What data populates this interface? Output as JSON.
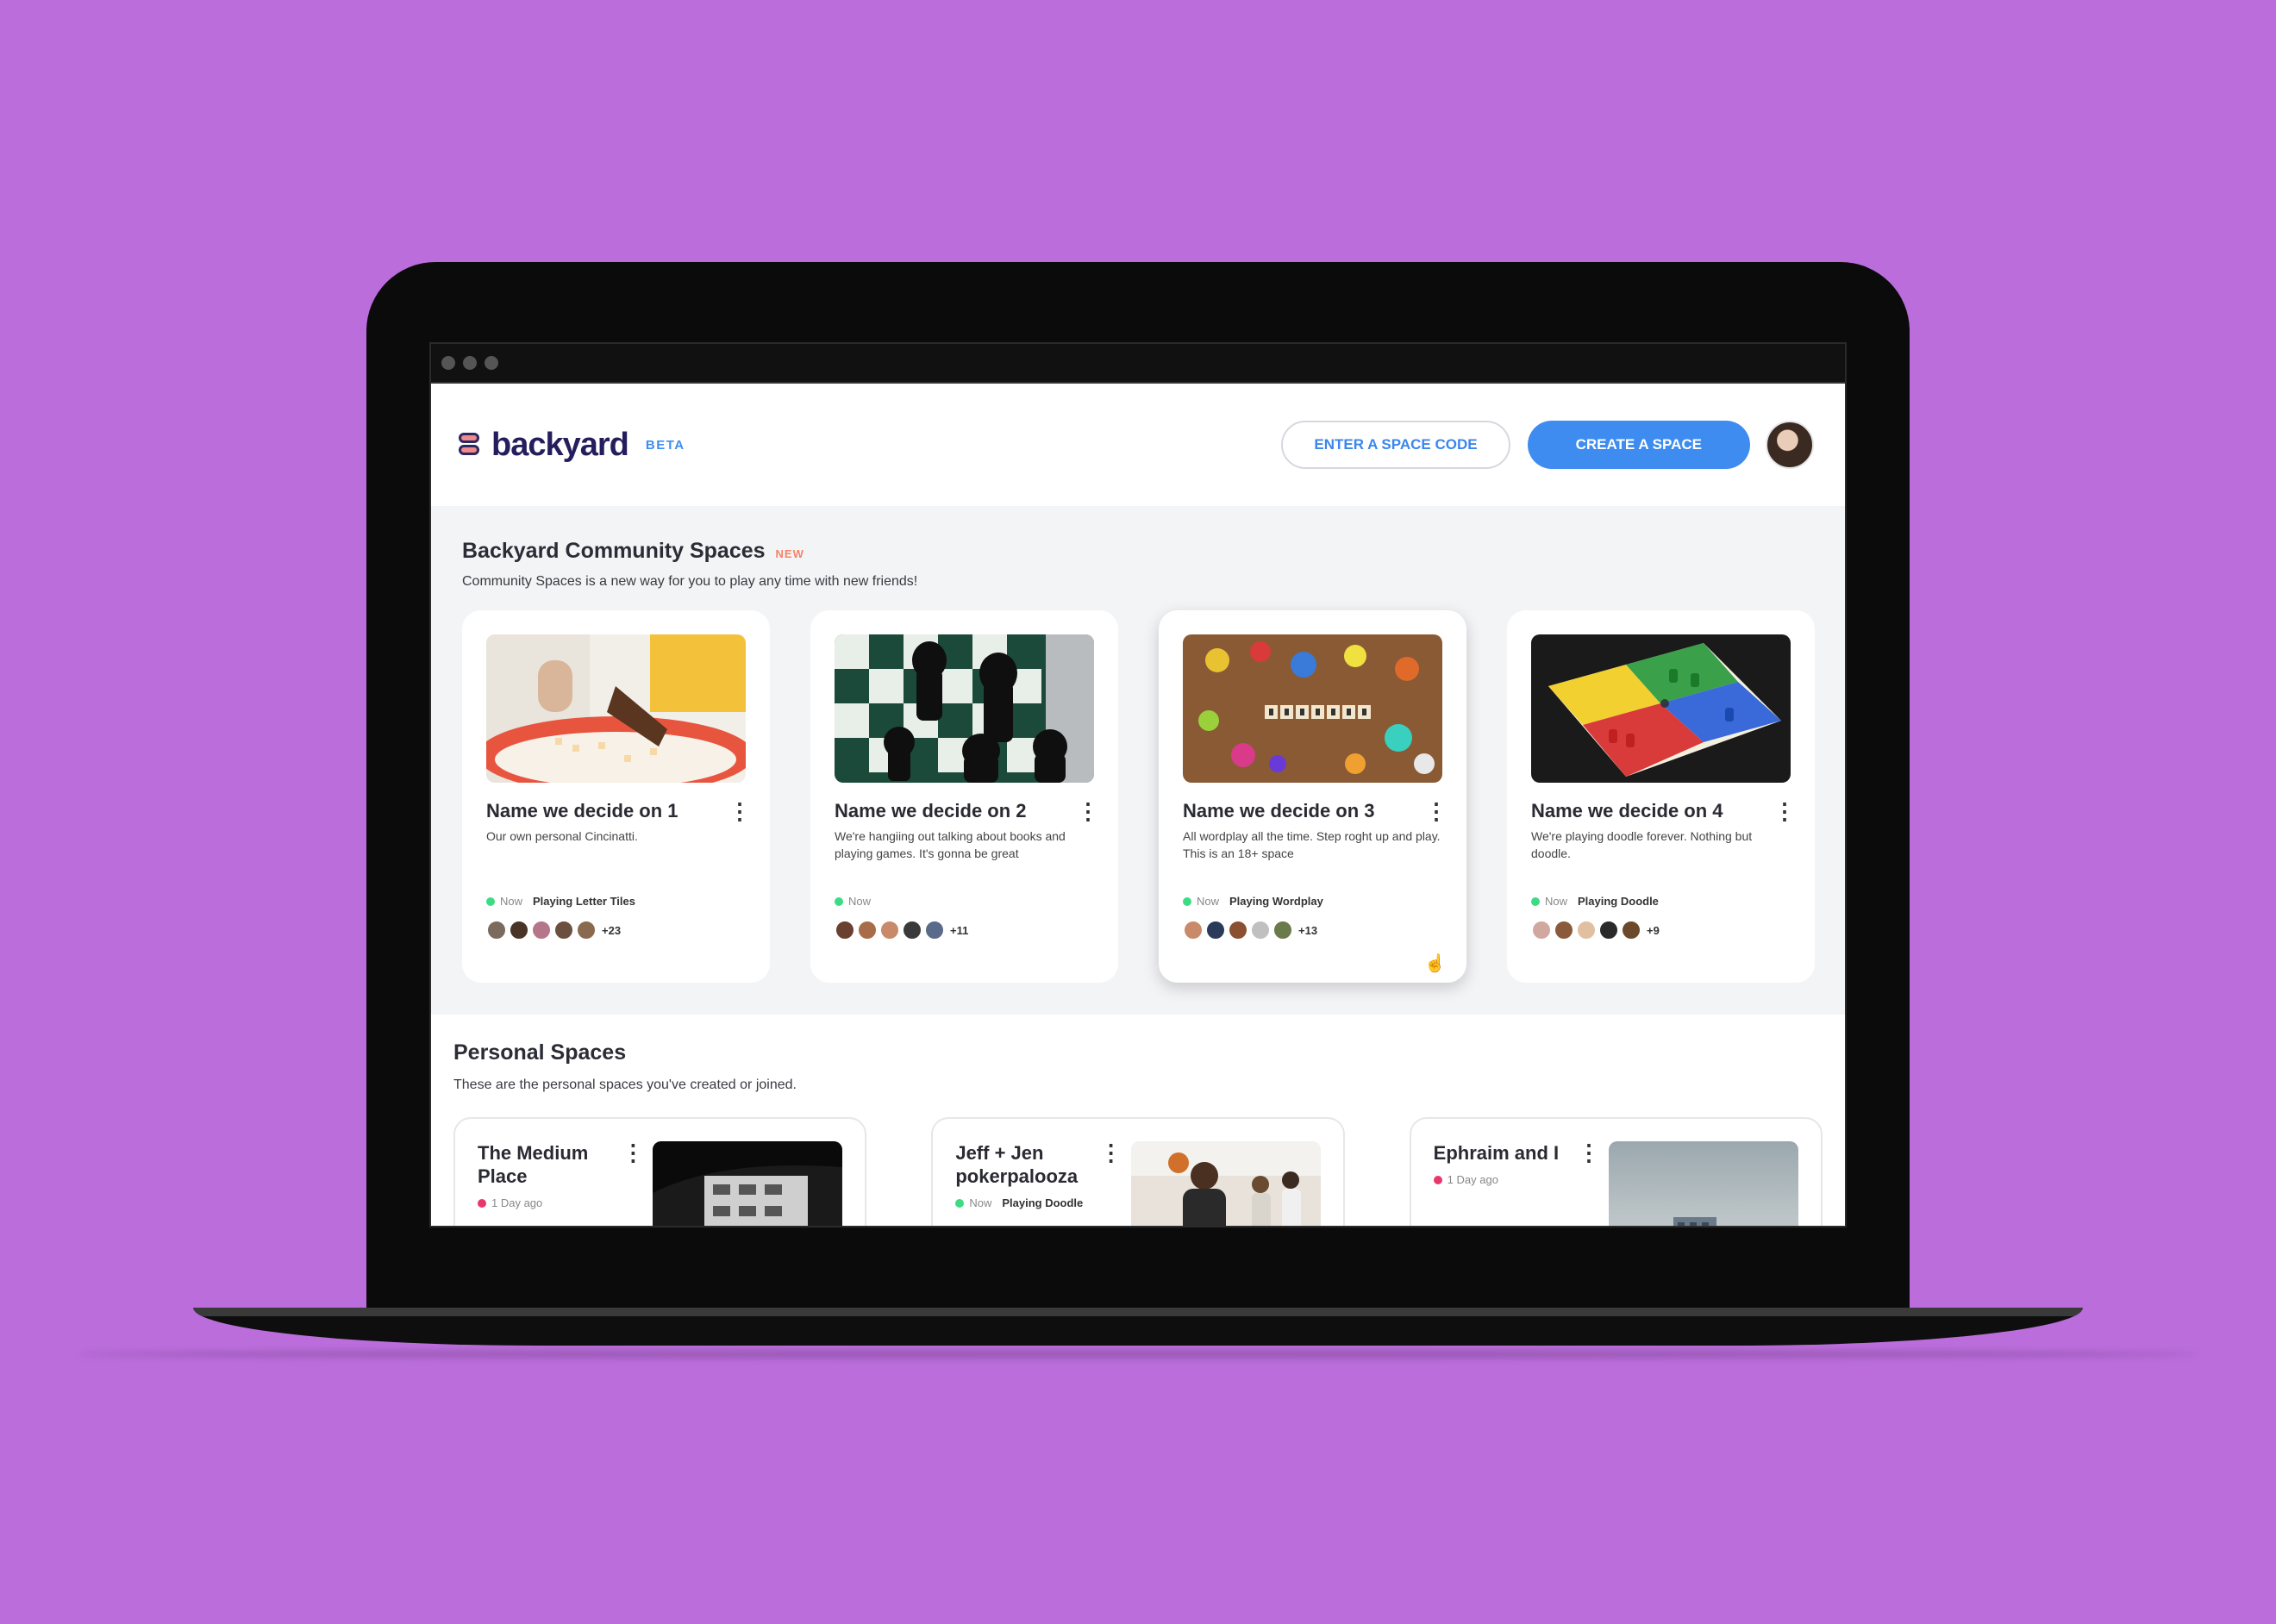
{
  "header": {
    "logo_text": "backyard",
    "beta_label": "BETA",
    "enter_code_label": "ENTER A SPACE CODE",
    "create_space_label": "CREATE A SPACE"
  },
  "community": {
    "title": "Backyard Community Spaces",
    "new_badge": "NEW",
    "subtitle": "Community Spaces is a new way for you to play any time with new friends!",
    "cards": [
      {
        "title": "Name we decide on 1",
        "desc": "Our own personal Cincinatti.",
        "now": "Now",
        "playing": "Playing Letter Tiles",
        "more": "+23"
      },
      {
        "title": "Name we decide on 2",
        "desc": "We're hangiing out talking about books and playing games. It's gonna be great",
        "now": "Now",
        "playing": "",
        "more": "+11"
      },
      {
        "title": "Name we decide on 3",
        "desc": "All wordplay all the time. Step roght up and play. This is an 18+ space",
        "now": "Now",
        "playing": "Playing Wordplay",
        "more": "+13"
      },
      {
        "title": "Name we decide on 4",
        "desc": "We're playing doodle forever. Nothing but doodle.",
        "now": "Now",
        "playing": "Playing Doodle",
        "more": "+9"
      }
    ]
  },
  "personal": {
    "title": "Personal Spaces",
    "subtitle": "These are the personal spaces you've created or joined.",
    "cards": [
      {
        "title": "The Medium Place",
        "time": "1 Day ago"
      },
      {
        "title": "Jeff + Jen pokerpalooza",
        "now": "Now",
        "playing": "Playing Doodle"
      },
      {
        "title": "Ephraim and I",
        "time": "1 Day ago"
      }
    ]
  },
  "icons": [
    "logo-icon",
    "kebab-menu-icon",
    "pointer-cursor-icon"
  ],
  "colors": {
    "background": "#bb6ddc",
    "accent": "#3e8cf0",
    "online": "#3ddc84",
    "offline": "#e8386b",
    "new_badge": "#f5836a"
  }
}
